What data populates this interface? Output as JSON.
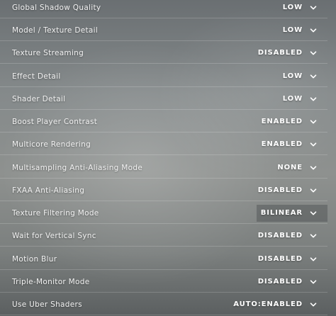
{
  "settings": [
    {
      "label": "Global Shadow Quality",
      "value": "LOW"
    },
    {
      "label": "Model / Texture Detail",
      "value": "LOW"
    },
    {
      "label": "Texture Streaming",
      "value": "DISABLED"
    },
    {
      "label": "Effect Detail",
      "value": "LOW"
    },
    {
      "label": "Shader Detail",
      "value": "LOW"
    },
    {
      "label": "Boost Player Contrast",
      "value": "ENABLED"
    },
    {
      "label": "Multicore Rendering",
      "value": "ENABLED"
    },
    {
      "label": "Multisampling Anti-Aliasing Mode",
      "value": "NONE"
    },
    {
      "label": "FXAA Anti-Aliasing",
      "value": "DISABLED"
    },
    {
      "label": "Texture Filtering Mode",
      "value": "BILINEAR"
    },
    {
      "label": "Wait for Vertical Sync",
      "value": "DISABLED"
    },
    {
      "label": "Motion Blur",
      "value": "DISABLED"
    },
    {
      "label": "Triple-Monitor Mode",
      "value": "DISABLED"
    },
    {
      "label": "Use Uber Shaders",
      "value": "AUTO:ENABLED"
    }
  ],
  "icons": {
    "dropdown": "chevron-down-icon"
  }
}
